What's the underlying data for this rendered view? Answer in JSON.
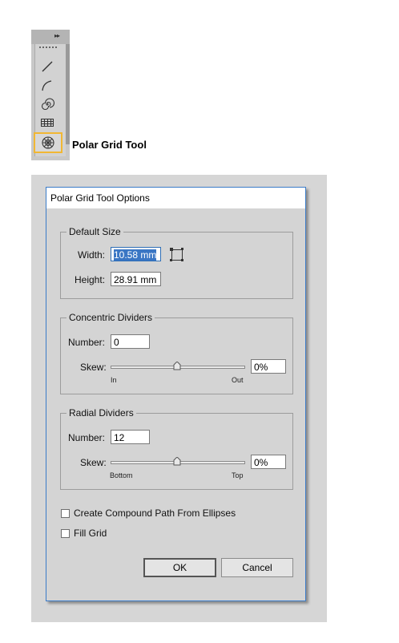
{
  "tool_label": "Polar Grid Tool",
  "dialog": {
    "title": "Polar Grid Tool Options",
    "default_size": {
      "legend": "Default Size",
      "width_label": "Width:",
      "width_value": "10.58 mm",
      "height_label": "Height:",
      "height_value": "28.91 mm"
    },
    "concentric": {
      "legend": "Concentric Dividers",
      "number_label": "Number:",
      "number_value": "0",
      "skew_label": "Skew:",
      "skew_value": "0%",
      "skew_min_label": "In",
      "skew_max_label": "Out"
    },
    "radial": {
      "legend": "Radial Dividers",
      "number_label": "Number:",
      "number_value": "12",
      "skew_label": "Skew:",
      "skew_value": "0%",
      "skew_min_label": "Bottom",
      "skew_max_label": "Top"
    },
    "compound_label": "Create Compound Path From Ellipses",
    "compound_checked": false,
    "fill_label": "Fill Grid",
    "fill_checked": false,
    "ok_label": "OK",
    "cancel_label": "Cancel"
  },
  "colors": {
    "selection_highlight": "#f1b733",
    "dialog_border": "#3a7bc8",
    "text_selection": "#3a76c4"
  }
}
